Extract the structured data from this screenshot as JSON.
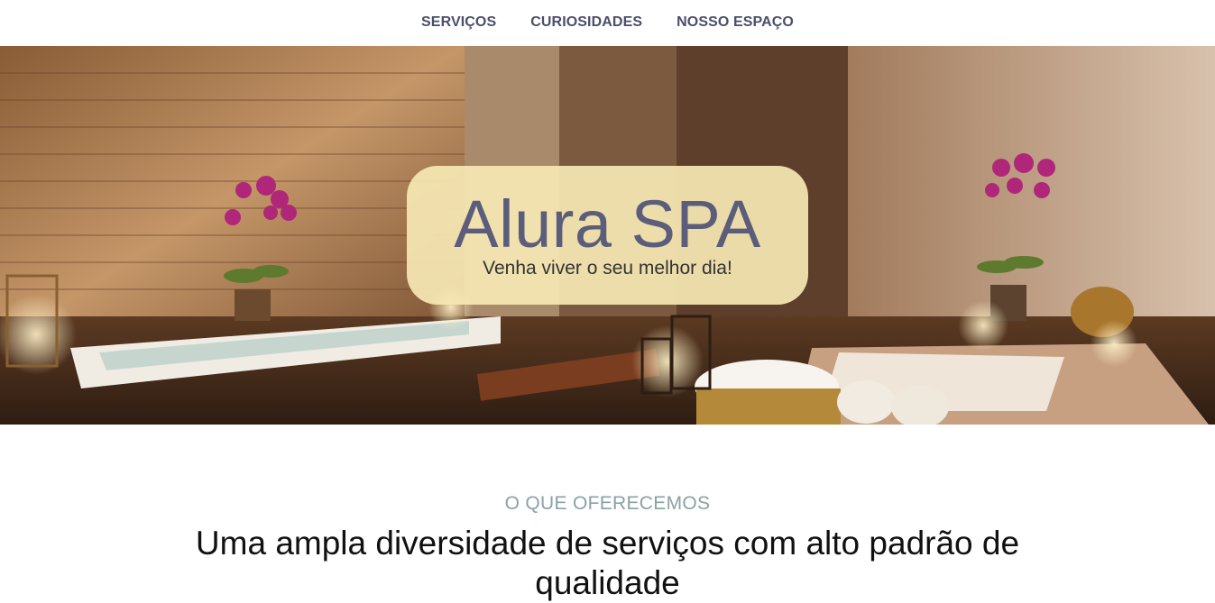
{
  "nav": {
    "items": [
      {
        "label": "SERVIÇOS"
      },
      {
        "label": "CURIOSIDADES"
      },
      {
        "label": "NOSSO ESPAÇO"
      }
    ]
  },
  "hero": {
    "title": "Alura SPA",
    "subtitle": "Venha viver o seu melhor dia!",
    "box_color": "#f6e8b4",
    "title_color": "#5b5d7a"
  },
  "services": {
    "kicker": "O QUE OFERECEMOS",
    "title": "Uma ampla diversidade de serviços com alto padrão de qualidade"
  },
  "colors": {
    "nav_text": "#4a4f6a",
    "kicker": "#8aa1a6"
  }
}
